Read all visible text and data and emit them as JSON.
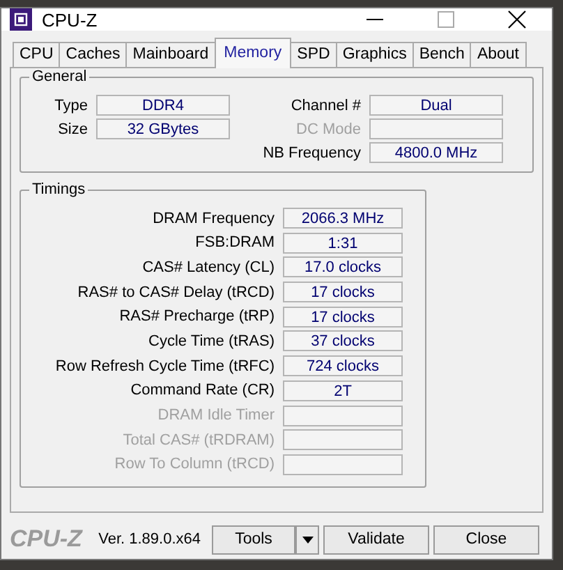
{
  "window": {
    "title": "CPU-Z"
  },
  "tabs": [
    {
      "label": "CPU",
      "selected": false
    },
    {
      "label": "Caches",
      "selected": false
    },
    {
      "label": "Mainboard",
      "selected": false
    },
    {
      "label": "Memory",
      "selected": true
    },
    {
      "label": "SPD",
      "selected": false
    },
    {
      "label": "Graphics",
      "selected": false
    },
    {
      "label": "Bench",
      "selected": false
    },
    {
      "label": "About",
      "selected": false
    }
  ],
  "general": {
    "title": "General",
    "left": [
      {
        "label": "Type",
        "value": "DDR4",
        "disabled": false
      },
      {
        "label": "Size",
        "value": "32 GBytes",
        "disabled": false
      }
    ],
    "right": [
      {
        "label": "Channel #",
        "value": "Dual",
        "disabled": false
      },
      {
        "label": "DC Mode",
        "disabled": true
      },
      {
        "label": "NB Frequency",
        "value": "4800.0 MHz",
        "disabled": false
      }
    ]
  },
  "timings": {
    "title": "Timings",
    "rows": [
      {
        "label": "DRAM Frequency",
        "value": "2066.3 MHz",
        "disabled": false
      },
      {
        "label": "FSB:DRAM",
        "value": "1:31",
        "disabled": false
      },
      {
        "label": "CAS# Latency (CL)",
        "value": "17.0 clocks",
        "disabled": false
      },
      {
        "label": "RAS# to CAS# Delay (tRCD)",
        "value": "17 clocks",
        "disabled": false
      },
      {
        "label": "RAS# Precharge (tRP)",
        "value": "17 clocks",
        "disabled": false
      },
      {
        "label": "Cycle Time (tRAS)",
        "value": "37 clocks",
        "disabled": false
      },
      {
        "label": "Row Refresh Cycle Time (tRFC)",
        "value": "724 clocks",
        "disabled": false
      },
      {
        "label": "Command Rate (CR)",
        "value": "2T",
        "disabled": false
      },
      {
        "label": "DRAM Idle Timer",
        "disabled": true
      },
      {
        "label": "Total CAS# (tRDRAM)",
        "disabled": true
      },
      {
        "label": "Row To Column (tRCD)",
        "disabled": true
      }
    ]
  },
  "footer": {
    "logo": "CPU-Z",
    "version": "Ver. 1.89.0.x64",
    "buttons": [
      "Tools",
      "Validate",
      "Close"
    ]
  }
}
